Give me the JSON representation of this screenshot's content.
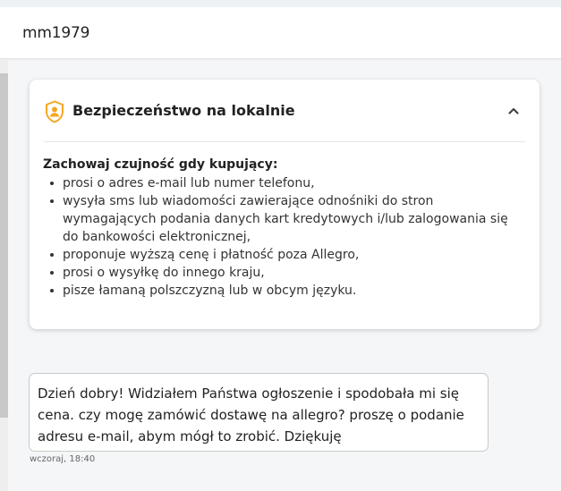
{
  "header": {
    "title": "mm1979"
  },
  "security_card": {
    "icon": "shield-user-icon",
    "title": "Bezpieczeństwo na lokalnie",
    "toggle_icon": "chevron-up-icon",
    "warning_title": "Zachowaj czujność gdy kupujący:",
    "items": [
      "prosi o adres e-mail lub numer telefonu,",
      "wysyła sms lub wiadomości zawierające odnośniki do stron wymagających podania danych kart kredytowych i/lub zalogowania się do bankowości elektronicznej,",
      "proponuje wyższą cenę i płatność poza Allegro,",
      "prosi o wysyłkę do innego kraju,",
      "pisze łamaną polszczyzną lub w obcym języku."
    ]
  },
  "message": {
    "text": "Dzień dobry! Widziałem Państwa ogłoszenie i spodobała mi się cena. czy mogę zamówić dostawę na allegro? proszę o podanie adresu e-mail, abym mógł to zrobić. Dziękuję",
    "timestamp": "wczoraj, 18:40"
  },
  "colors": {
    "accent": "#f5a623",
    "card_background": "#ffffff",
    "page_background": "#f5f6f8",
    "bubble_border": "#c9c9c9"
  }
}
